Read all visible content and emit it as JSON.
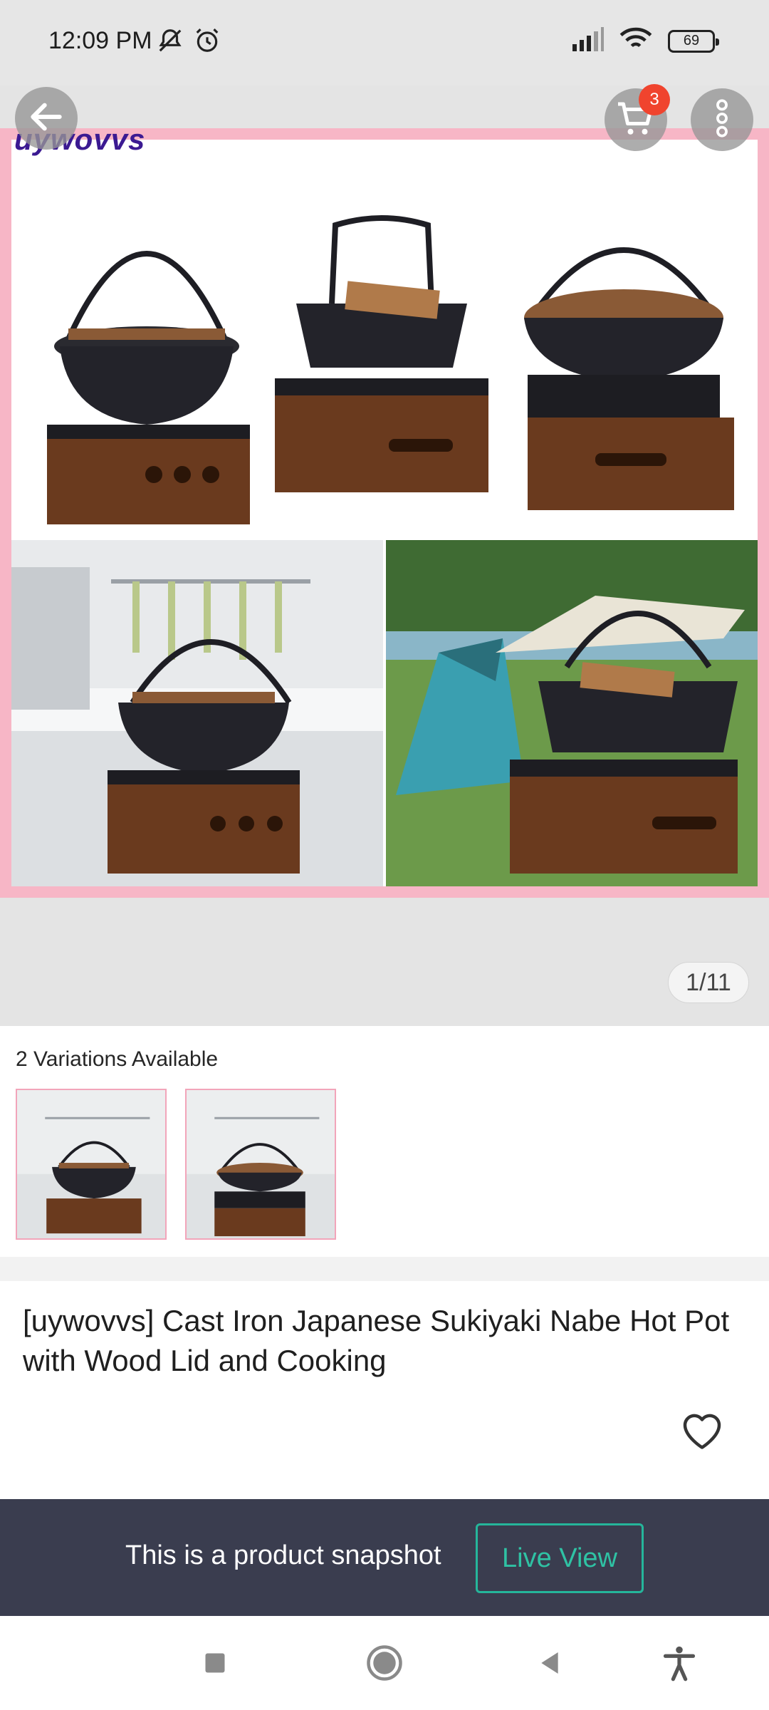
{
  "status_bar": {
    "time": "12:09 PM",
    "battery": "69",
    "icons": [
      "mute-bell-icon",
      "alarm-icon",
      "signal-icon",
      "wifi-icon",
      "battery-icon"
    ]
  },
  "header": {
    "cart_count": "3",
    "icons": [
      "back-arrow-icon",
      "cart-icon",
      "more-vertical-icon"
    ]
  },
  "gallery": {
    "brand_mark": "uywovvs",
    "counter": "1/11"
  },
  "variations": {
    "label": "2 Variations Available",
    "count": 2
  },
  "product": {
    "title": "[uywovvs] Cast Iron Japanese Sukiyaki Nabe Hot Pot with Wood Lid and Cooking"
  },
  "snapshot": {
    "message": "This is a product snapshot",
    "button_label": "Live View"
  },
  "colors": {
    "accent_pink": "#f7b6c6",
    "badge_red": "#f0442e",
    "snapshot_bg": "#3a3d4f",
    "live_view_green": "#2fc2a4"
  }
}
